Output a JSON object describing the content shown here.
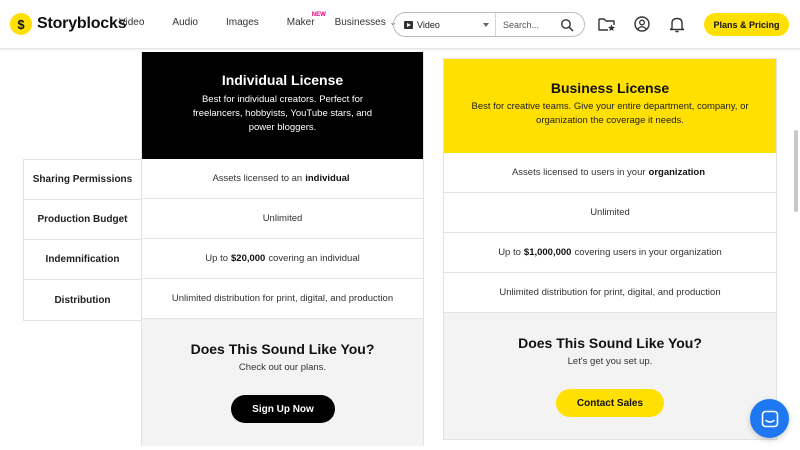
{
  "header": {
    "logo_mark": "$",
    "logo_text": "Storyblocks",
    "nav": [
      {
        "label": "Video"
      },
      {
        "label": "Audio"
      },
      {
        "label": "Images"
      },
      {
        "label": "Maker",
        "badge": "NEW"
      },
      {
        "label": "Businesses"
      }
    ],
    "search": {
      "type_label": "Video",
      "placeholder": "Search..."
    },
    "plans_button": "Plans & Pricing"
  },
  "labels": [
    "Sharing Permissions",
    "Production Budget",
    "Indemnification",
    "Distribution"
  ],
  "individual": {
    "title": "Individual License",
    "subtitle": "Best for individual creators. Perfect for freelancers, hobbyists, YouTube stars, and power bloggers.",
    "rows": [
      {
        "pre": "Assets licensed to an",
        "bold": "individual",
        "post": ""
      },
      {
        "pre": "Unlimited",
        "bold": "",
        "post": ""
      },
      {
        "pre": "Up to",
        "bold": "$20,000",
        "post": "covering an individual"
      },
      {
        "pre": "Unlimited distribution for print, digital, and production",
        "bold": "",
        "post": ""
      }
    ],
    "footer_title": "Does This Sound Like You?",
    "footer_sub": "Check out our plans.",
    "button": "Sign Up Now"
  },
  "business": {
    "title": "Business License",
    "subtitle": "Best for creative teams. Give your entire department, company, or organization the coverage it needs.",
    "rows": [
      {
        "pre": "Assets licensed to users in your",
        "bold": "organization",
        "post": ""
      },
      {
        "pre": "Unlimited",
        "bold": "",
        "post": ""
      },
      {
        "pre": "Up to",
        "bold": "$1,000,000",
        "post": "covering users in your organization"
      },
      {
        "pre": "Unlimited distribution for print, digital, and production",
        "bold": "",
        "post": ""
      }
    ],
    "footer_title": "Does This Sound Like You?",
    "footer_sub": "Let's get you set up.",
    "button": "Contact Sales"
  },
  "colors": {
    "brand_yellow": "#ffe000",
    "chat_blue": "#1d78f2",
    "new_badge": "#e5007e"
  }
}
